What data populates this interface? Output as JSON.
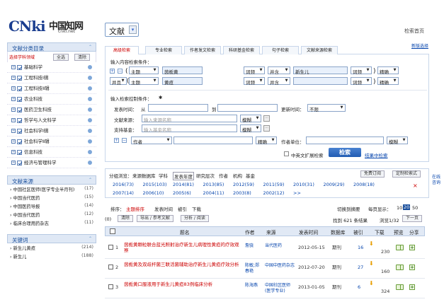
{
  "header": {
    "logo_text": "CNki",
    "logo_chinese": "中国知网",
    "logo_url": "cnki.net",
    "db_select": "文献",
    "home_link": "检索首页",
    "old_version": "新版选择"
  },
  "left": {
    "category_title": "文献分类目录",
    "select_hint": "选择学科领域",
    "btn_all": "全选",
    "btn_clear": "清除",
    "categories": [
      "基础科学",
      "工程科技Ⅰ辑",
      "工程科技Ⅱ辑",
      "农业科技",
      "医药卫生科技",
      "哲学与人文科学",
      "社会科学Ⅰ辑",
      "社会科学Ⅱ辑",
      "信息科技",
      "经济与管理科学"
    ],
    "source_title": "文献来源",
    "sources": [
      {
        "name": "中国社区医师(医学专业半月刊)",
        "count": "(17)"
      },
      {
        "name": "中国当代医药",
        "count": "(15)"
      },
      {
        "name": "中国医药导报",
        "count": "(14)"
      },
      {
        "name": "中国当代医药",
        "count": "(12)"
      },
      {
        "name": "临床合理用药杂志",
        "count": "(11)"
      }
    ],
    "keyword_title": "关键词",
    "keywords": [
      {
        "name": "新生儿黄疸",
        "count": "(214)"
      },
      {
        "name": "新生儿",
        "count": "(188)"
      }
    ]
  },
  "tabs": [
    "高级检索",
    "专业检索",
    "作者发文检索",
    "科研基金检索",
    "句子检索",
    "文献来源检索"
  ],
  "search": {
    "content_label": "输入内容检索条件：",
    "row1": {
      "field": "主题",
      "term1": "茵栀黄",
      "freq1": "词频",
      "op": "并含",
      "term2": "新生儿",
      "freq2": "词频",
      "match": "精确"
    },
    "row2": {
      "logic": "并且",
      "field": "主题",
      "term1": "黄疸",
      "freq1": "词频",
      "op": "并含",
      "term2": "",
      "freq2": "词频",
      "match": "精确"
    },
    "control_label": "输入检索控制条件：",
    "pub_time": "发表时间：",
    "from": "从",
    "to": "到",
    "update_time": "更新时间：",
    "update_val": "不限",
    "source_label": "文献来源：",
    "source_ph": "输入来源名称",
    "source_match": "模糊",
    "fund_label": "支持基金：",
    "fund_ph": "输入基金名称",
    "fund_match": "模糊",
    "author_field": "作者",
    "author_match": "精确",
    "unit_label": "作者单位：",
    "unit_match": "模糊",
    "expand": "中英文扩展检索",
    "btn": "检索",
    "adv_link": "结果中检索"
  },
  "group": {
    "label": "分组浏览：",
    "items": [
      "来源数据库",
      "学科",
      "发表年度",
      "研究层次",
      "作者",
      "机构",
      "基金"
    ],
    "btn_free": "免费订阅",
    "btn_dl": "定制检索式",
    "years_row1": [
      "2016(73)",
      "2015(103)",
      "2014(81)",
      "2013(85)",
      "2012(59)",
      "2011(59)",
      "2010(31)",
      "2009(29)",
      "2008(18)"
    ],
    "years_row2": [
      "2007(14)",
      "2006(10)",
      "2005(6)",
      "2004(11)",
      "2003(8)",
      "2002(12)",
      ">>"
    ],
    "right_note": "在线咨询"
  },
  "sort": {
    "label": "排序：",
    "items": [
      "主题排序",
      "发表时间",
      "被引",
      "下载"
    ],
    "switch": "切换到摘要",
    "perpage_label": "每页显示：",
    "perpage": [
      "10",
      "20",
      "50"
    ]
  },
  "toolbar": {
    "selected": "(0)",
    "clear": "清除",
    "export": "导出 / 参考文献",
    "analyze": "分析 / 阅读",
    "found": "找到 621 条结果",
    "page": "浏览1/32",
    "next": "下一页"
  },
  "table": {
    "headers": [
      "题名",
      "作者",
      "来源",
      "发表时间",
      "数据库",
      "被引",
      "下载",
      "预览",
      "分享"
    ],
    "rows": [
      {
        "no": "1",
        "title_a": "茵栀黄颗粒联合蓝光照射治疗",
        "title_hl": "新生儿",
        "title_b": "病理性黄疸的疗效观察",
        "author": "詹骁",
        "source": "当代医药",
        "date": "2012-05-15",
        "db": "期刊",
        "cited": "16",
        "dl": "230"
      },
      {
        "no": "2",
        "title_a": "茵栀黄及双歧杆菌三联活菌辅助治疗",
        "title_hl": "新生",
        "title_b": "儿黄疸疗效分析",
        "author": "陈敏;郑春艳",
        "source": "中国中医药杂志",
        "date": "2012-07-20",
        "db": "期刊",
        "cited": "27",
        "dl": "160"
      },
      {
        "no": "3",
        "title_a": "茵栀黄口服液用于",
        "title_hl": "新生儿",
        "title_b": "黄疸83例临床分析",
        "author": "陈海燕",
        "source": "中国社区医师(医学专业)",
        "date": "2013-01-05",
        "db": "期刊",
        "cited": "6",
        "dl": "324"
      }
    ]
  }
}
